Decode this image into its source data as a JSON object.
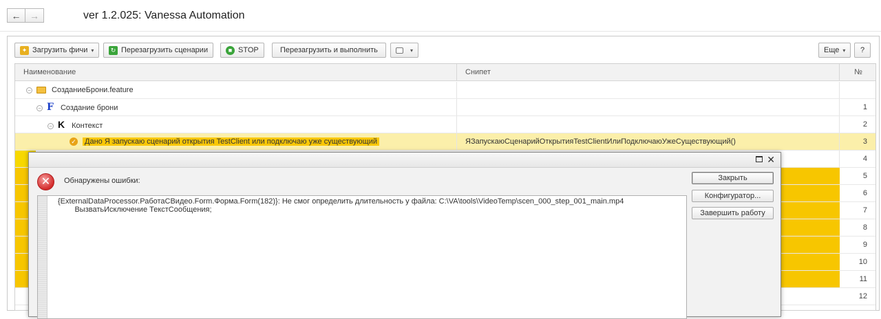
{
  "window": {
    "title": "ver 1.2.025: Vanessa Automation"
  },
  "nav": {
    "back": "←",
    "forward": "→"
  },
  "toolbar": {
    "load_features": "Загрузить фичи",
    "reload_scenarios": "Перезагрузить сценарии",
    "stop": "STOP",
    "reload_and_run": "Перезагрузить и выполнить",
    "more": "Еще",
    "help": "?"
  },
  "grid": {
    "columns": {
      "name": "Наименование",
      "snippet": "Снипет",
      "number": "№"
    },
    "rows": [
      {
        "name": "СозданиеБрони.feature",
        "snippet": "",
        "number": ""
      },
      {
        "name": "Создание брони",
        "snippet": "",
        "number": "1"
      },
      {
        "name": "Контекст",
        "snippet": "",
        "number": "2"
      },
      {
        "name": "Дано Я запускаю сценарий открытия TestClient или подключаю уже существующий",
        "snippet": "ЯЗапускаюСценарийОткрытияTestClientИлиПодключаюУжеСуществующий()",
        "number": "3"
      },
      {
        "number": "4"
      },
      {
        "number": "5"
      },
      {
        "number": "6"
      },
      {
        "number": "7"
      },
      {
        "number": "8"
      },
      {
        "number": "9"
      },
      {
        "number": "10"
      },
      {
        "number": "11"
      },
      {
        "number": "12"
      }
    ]
  },
  "dialog": {
    "caption": "Обнаружены ошибки:",
    "error_line1": "{ExternalDataProcessor.РаботаСВидео.Form.Форма.Form(182)}: Не смог определить длительность у файла: C:\\VA\\tools\\VideoTemp\\scen_000_step_001_main.mp4",
    "error_line2": "        ВызватьИсключение ТекстСообщения;",
    "close": "Закрыть",
    "configurator": "Конфигуратор...",
    "exit": "Завершить работу"
  },
  "colors": {
    "highlight": "#f9c706",
    "selected_row": "#fbefaa",
    "error": "#d42c2c"
  }
}
